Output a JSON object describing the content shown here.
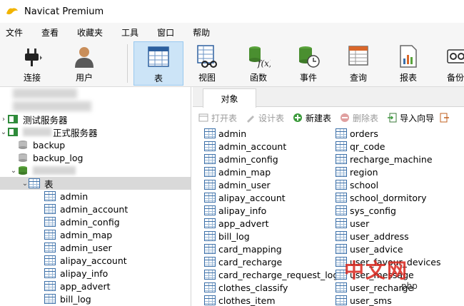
{
  "app": {
    "title": "Navicat Premium"
  },
  "menu": [
    "文件",
    "查看",
    "收藏夹",
    "工具",
    "窗口",
    "帮助"
  ],
  "toolbar": [
    {
      "label": "连接",
      "icon": "plug-icon"
    },
    {
      "label": "用户",
      "icon": "user-icon"
    },
    {
      "label": "表",
      "icon": "table-icon",
      "active": true
    },
    {
      "label": "视图",
      "icon": "view-icon"
    },
    {
      "label": "函数",
      "icon": "function-icon"
    },
    {
      "label": "事件",
      "icon": "event-icon"
    },
    {
      "label": "查询",
      "icon": "query-icon"
    },
    {
      "label": "报表",
      "icon": "report-icon"
    },
    {
      "label": "备份",
      "icon": "backup-icon"
    }
  ],
  "tree": {
    "server1": "测试服务器",
    "server2": "正式服务器",
    "db1": "backup",
    "db2": "backup_log",
    "tables_node": "表",
    "tables": [
      "admin",
      "admin_account",
      "admin_config",
      "admin_map",
      "admin_user",
      "alipay_account",
      "alipay_info",
      "app_advert",
      "bill_log"
    ]
  },
  "tab": {
    "label": "对象"
  },
  "object_toolbar": {
    "open": "打开表",
    "design": "设计表",
    "new": "新建表",
    "delete": "删除表",
    "import": "导入向导"
  },
  "objects_col1": [
    "admin",
    "admin_account",
    "admin_config",
    "admin_map",
    "admin_user",
    "alipay_account",
    "alipay_info",
    "app_advert",
    "bill_log",
    "card_mapping",
    "card_recharge",
    "card_recharge_request_log",
    "clothes_classify",
    "clothes_item"
  ],
  "objects_col2": [
    "orders",
    "qr_code",
    "recharge_machine",
    "region",
    "school",
    "school_dormitory",
    "sys_config",
    "user",
    "user_address",
    "user_advice",
    "user_favour_devices",
    "user_message",
    "user_recharge",
    "user_sms"
  ],
  "watermark": {
    "text": "中文网",
    "sub": "php"
  }
}
